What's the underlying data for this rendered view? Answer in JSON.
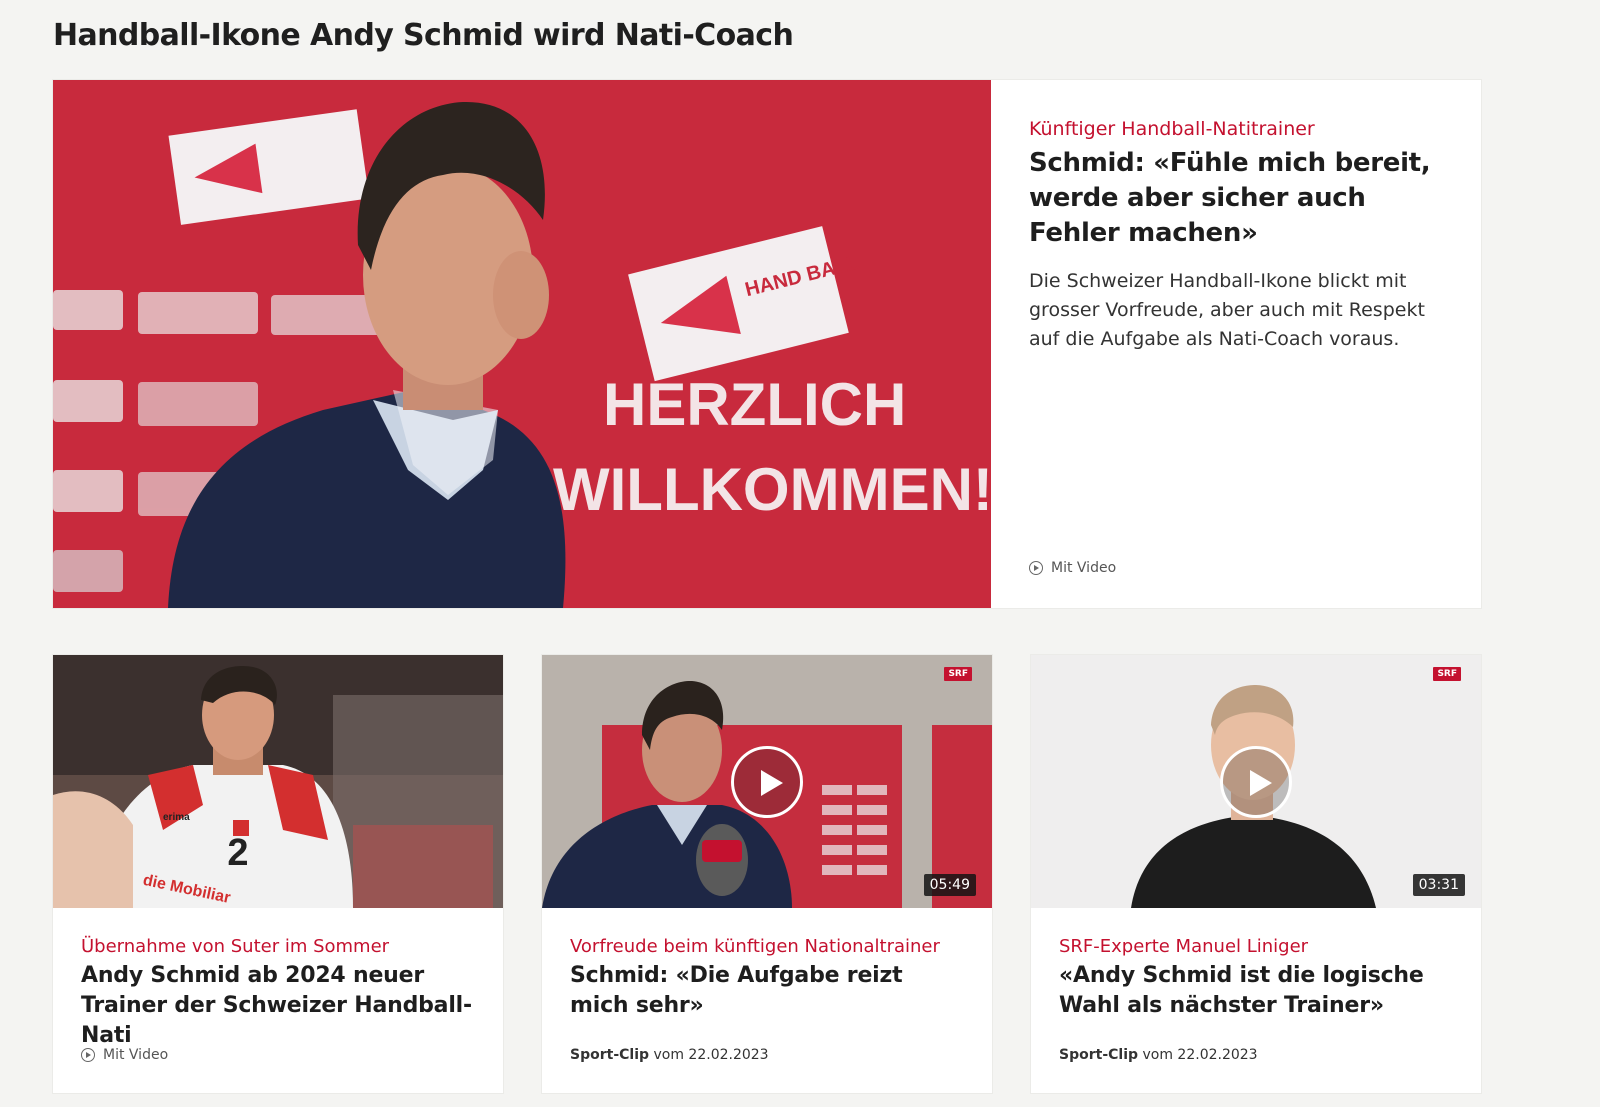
{
  "section": {
    "title": "Handball-Ikone Andy Schmid wird Nati-Coach"
  },
  "hero": {
    "kicker": "Künftiger Handball-Natitrainer",
    "headline": "Schmid: «Fühle mich bereit, werde aber sicher auch Fehler machen»",
    "lead": "Die Schweizer Handball-Ikone blickt mit grosser Vorfreude, aber auch mit Respekt auf die Aufgabe als Nati-Coach voraus.",
    "meta": "Mit Video",
    "image_text": {
      "banner_line1": "HERZLICH",
      "banner_line2": "WILLKOMMEN!",
      "logo_text": "HAND BALL"
    }
  },
  "teasers": [
    {
      "kicker": "Übernahme von Suter im Sommer",
      "headline": "Andy Schmid ab 2024 neuer Trainer der Schweizer Handball-Nati",
      "meta": "Mit Video",
      "image_text": {
        "jersey_number": "2",
        "brand": "erima",
        "sponsor": "die Mobiliar"
      }
    },
    {
      "kicker": "Vorfreude beim künftigen Nationaltrainer",
      "headline": "Schmid: «Die Aufgabe reizt mich sehr»",
      "clip_label": "Sport-Clip",
      "clip_date": "vom 22.02.2023",
      "duration": "05:49",
      "badge": "SRF"
    },
    {
      "kicker": "SRF-Experte Manuel Liniger",
      "headline": "«Andy Schmid ist die logische Wahl als nächster Trainer»",
      "clip_label": "Sport-Clip",
      "clip_date": "vom 22.02.2023",
      "duration": "03:31",
      "badge": "SRF"
    }
  ],
  "colors": {
    "accent": "#c4112f",
    "background": "#f4f4f2",
    "card": "#ffffff"
  }
}
